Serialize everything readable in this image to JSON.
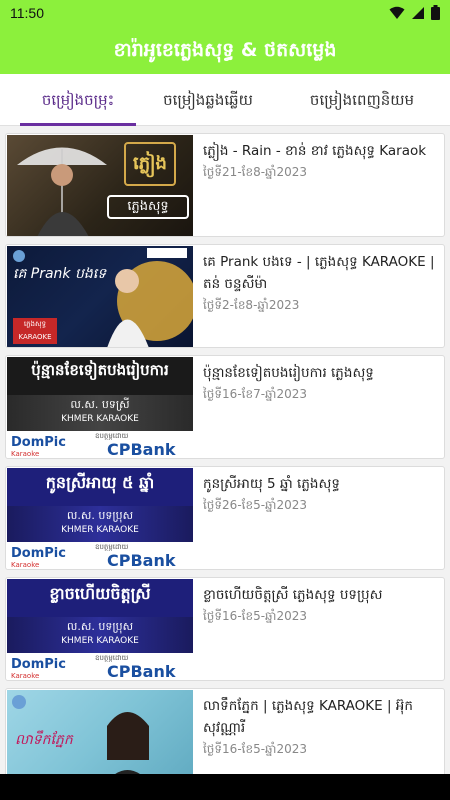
{
  "status": {
    "time": "11:50"
  },
  "app": {
    "title": "ខារ៉ាអូខេភ្លេងសុទ្ធ & ថតសម្លេង",
    "accent": "#8cf03c",
    "tab_accent": "#6a2fa0"
  },
  "tabs": [
    {
      "label": "ចម្រៀងចម្រុះ"
    },
    {
      "label": "ចម្រៀងឆ្លងឆ្លើយ"
    },
    {
      "label": "ចម្រៀងពេញនិយម"
    }
  ],
  "songs": [
    {
      "title": "ភ្លៀង - Rain - ខាន់ ខាវ ភ្លេងសុទ្ធ Karaok",
      "date": "ថ្ងៃទី21-ខែ8-ឆ្នាំ2023",
      "thumb_text": "ភ្លៀង",
      "thumb_sub": "ភ្លេងសុទ្ធ"
    },
    {
      "title": "គេ Prank បងទេ - | ភ្លេងសុទ្ធ KARAOKE | តន់ ចន្ទសីម៉ា",
      "date": "ថ្ងៃទី2-ខែ8-ឆ្នាំ2023",
      "thumb_text": "គេ Prank បងទេ",
      "thumb_sub": "ភ្លេងសុទ្ធ KARAOKE"
    },
    {
      "title": "ប៉ុន្មានខែទៀតបងរៀបការ ភ្លេងសុទ្ធ",
      "date": "ថ្ងៃទី16-ខែ7-ឆ្នាំ2023",
      "thumb_text": "ប៉ុន្មានខែទៀតបងរៀបការ",
      "thumb_voice": "ល.ស. បទស្រី",
      "thumb_karaoke": "KHMER KARAOKE",
      "thumb_sponsor": "ឧបត្ថម្ភដោយ",
      "thumb_dompic": "DomPic",
      "thumb_dompic_sub": "Karaoke",
      "thumb_bank": "CPBank"
    },
    {
      "title": "កូនស្រីអាយុ 5 ឆ្នាំ ភ្លេងសុទ្ធ",
      "date": "ថ្ងៃទី26-ខែ5-ឆ្នាំ2023",
      "thumb_text": "កូនស្រីអាយុ ៥ ឆ្នាំ",
      "thumb_voice": "ល.ស. បទប្រុស",
      "thumb_karaoke": "KHMER KARAOKE",
      "thumb_sponsor": "ឧបត្ថម្ភដោយ",
      "thumb_dompic": "DomPic",
      "thumb_dompic_sub": "Karaoke",
      "thumb_bank": "CPBank"
    },
    {
      "title": "ខ្លាចហើយចិត្តស្រី ភ្លេងសុទ្ធ បទប្រុស",
      "date": "ថ្ងៃទី16-ខែ5-ឆ្នាំ2023",
      "thumb_text": "ខ្លាចហើយចិត្តស្រី",
      "thumb_voice": "ល.ស. បទប្រុស",
      "thumb_karaoke": "KHMER KARAOKE",
      "thumb_sponsor": "ឧបត្ថម្ភដោយ",
      "thumb_dompic": "DomPic",
      "thumb_dompic_sub": "Karaoke",
      "thumb_bank": "CPBank"
    },
    {
      "title": "លាទឹកភ្នែក | ភ្លេងសុទ្ធ KARAOKE | អ៊ុក សុវណ្ណារី",
      "date": "ថ្ងៃទី16-ខែ5-ឆ្នាំ2023",
      "thumb_text": "លាទឹកភ្នែក"
    }
  ]
}
